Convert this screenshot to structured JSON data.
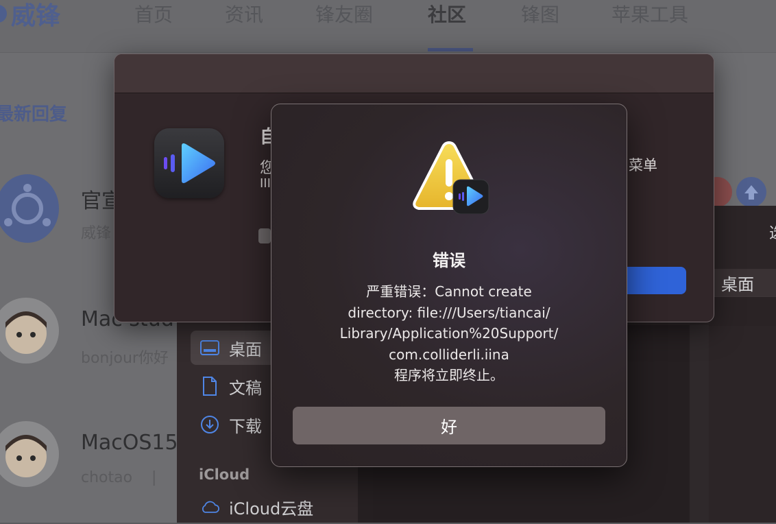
{
  "site": {
    "logo_text": "威锋",
    "nav": [
      "首页",
      "资讯",
      "锋友圈",
      "社区",
      "锋图",
      "苹果工具"
    ],
    "active_nav": "社区",
    "section_title": "最新回复",
    "posts": [
      {
        "title": "官宣",
        "sub": "威锋"
      },
      {
        "title": "Mac stud",
        "sub": "bonjour你好"
      },
      {
        "title": "MacOS15",
        "sub": "chotao    |"
      }
    ],
    "colors": {
      "brand": "#4d5e8d"
    }
  },
  "finder": {
    "sidebar_items": [
      {
        "label": "桌面",
        "icon": "desktop-icon",
        "selected": true
      },
      {
        "label": "文稿",
        "icon": "document-icon",
        "selected": false
      },
      {
        "label": "下载",
        "icon": "download-icon",
        "selected": false
      }
    ],
    "group_label": "iCloud",
    "icloud_item": {
      "label": "iCloud云盘",
      "icon": "cloud-icon"
    },
    "path_label": "桌面",
    "edge_text": "选"
  },
  "update_dialog": {
    "title_fragment": "自",
    "line1_fragment": "您",
    "line2_fragment": "III",
    "menu_fragment": "菜单"
  },
  "alert": {
    "title": "错误",
    "message": "严重错误：Cannot create\ndirectory: file:///Users/tiancai/\nLibrary/Application%20Support/\ncom.colliderli.iina\n程序将立即终止。",
    "ok_button": "好",
    "icon": "warning-triangle-icon"
  }
}
